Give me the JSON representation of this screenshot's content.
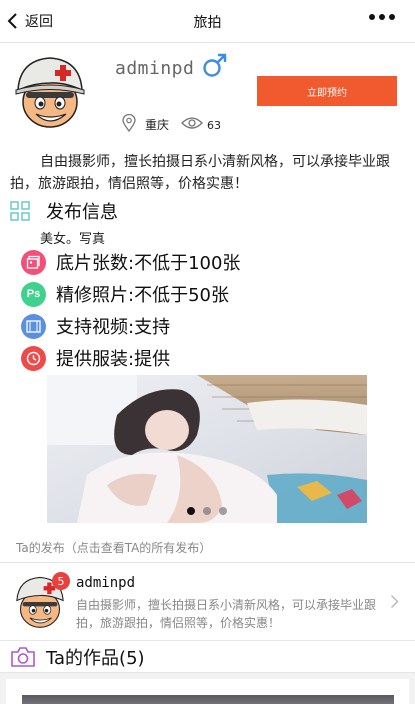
{
  "nav": {
    "back_label": "返回",
    "title": "旅拍"
  },
  "profile": {
    "username": "adminpd",
    "book_label": "立即预约",
    "location": "重庆",
    "views": "63",
    "bio": "自由摄影师，擅长拍摄日系小清新风格，可以承接毕业跟拍，旅游跟拍，情侣照等，价格实惠！"
  },
  "publish": {
    "title": "发布信息",
    "desc": "美女。写真",
    "features": [
      {
        "text": "底片张数:不低于100张",
        "icon": "photos-icon",
        "color": "#f0507a"
      },
      {
        "text": "精修照片:不低于50张",
        "icon": "ps-icon",
        "color": "#3ed28e"
      },
      {
        "text": "支持视频:支持",
        "icon": "film-icon",
        "color": "#5b8fe0"
      },
      {
        "text": "提供服装:提供",
        "icon": "clock-icon",
        "color": "#ee4a4a"
      }
    ]
  },
  "carousel": {
    "count": 3,
    "active": 0
  },
  "ta_publish": "Ta的发布（点击查看TA的所有发布）",
  "user_card": {
    "name": "adminpd",
    "badge": "5",
    "bio": "自由摄影师，擅长拍摄日系小清新风格，可以承接毕业跟拍，旅游跟拍，情侣照等，价格实惠！"
  },
  "works": {
    "title": "Ta的作品(5)"
  },
  "colors": {
    "accent": "#f15a2e",
    "male": "#3a8ee6",
    "grid": "#6cc7d1",
    "camera": "#b056c9",
    "badge": "#e8403c"
  }
}
